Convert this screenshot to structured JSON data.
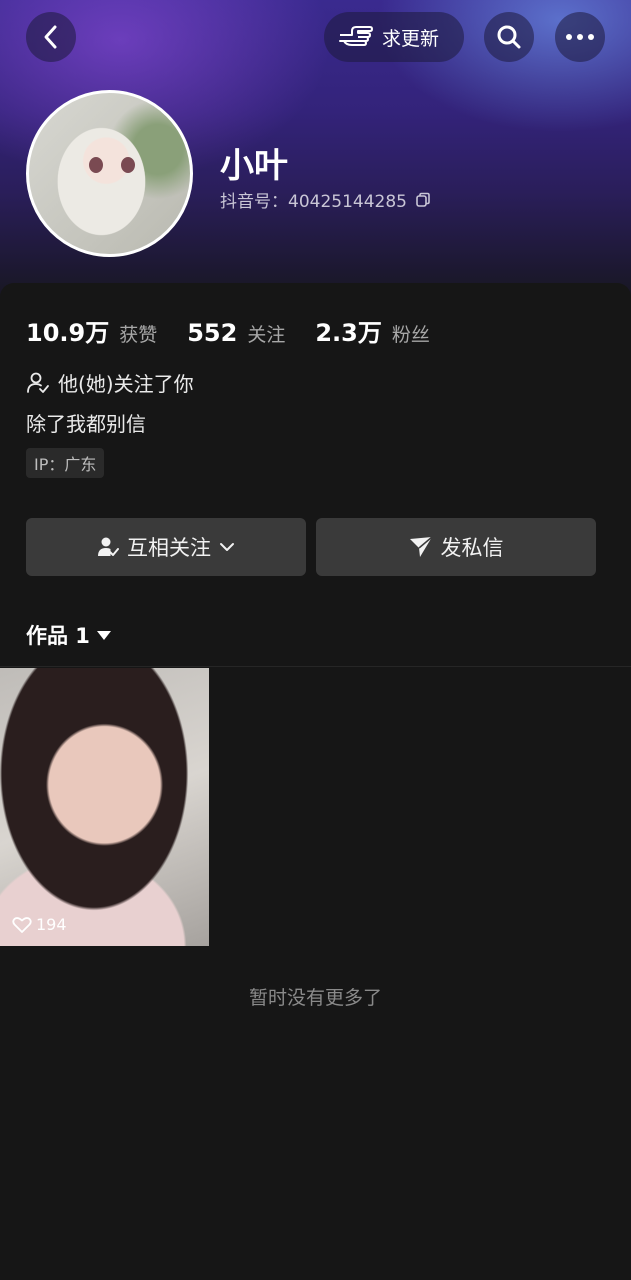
{
  "header": {
    "update_label": "求更新"
  },
  "profile": {
    "name": "小叶",
    "uid": "抖音号：40425144285"
  },
  "stats": [
    {
      "value": "10.9万",
      "label": "获赞"
    },
    {
      "value": "552",
      "label": "关注"
    },
    {
      "value": "2.3万",
      "label": "粉丝"
    }
  ],
  "follow_note": "他(她)关注了你",
  "bio": "除了我都别信",
  "ip": "IP：广东",
  "actions": {
    "mutual_label": "互相关注",
    "message_label": "发私信"
  },
  "works": {
    "tab_label": "作品 1",
    "items": [
      {
        "likes": "194"
      }
    ]
  },
  "end_text": "暂时没有更多了",
  "colors": {
    "background": "#161616",
    "button_bg": "#3a3a3a",
    "header_purple": "#3a2a8f"
  }
}
